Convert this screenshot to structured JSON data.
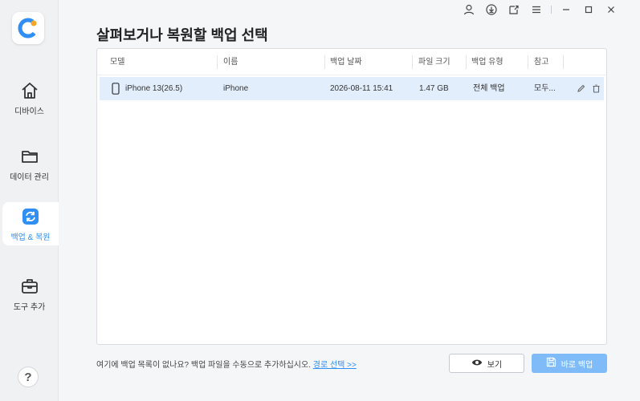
{
  "sidebar": {
    "items": [
      {
        "label": "디바이스",
        "icon": "home-icon"
      },
      {
        "label": "데이터 관리",
        "icon": "folder-icon"
      },
      {
        "label": "백업 & 복원",
        "icon": "sync-icon",
        "active": true
      },
      {
        "label": "도구 추가",
        "icon": "toolbox-icon"
      }
    ],
    "help": "?"
  },
  "page": {
    "title": "살펴보거나 복원할 백업 선택"
  },
  "table": {
    "headers": [
      "모델",
      "이름",
      "백업 날짜",
      "파일 크기",
      "백업 유형",
      "참고"
    ],
    "rows": [
      {
        "model": "iPhone 13(26.5)",
        "name": "iPhone",
        "date": "2026-08-11 15:41",
        "size": "1.47 GB",
        "type": "전체 백업",
        "note": "모두..."
      }
    ]
  },
  "footer": {
    "hint": "여기에 백업 목록이 없나요? 백업 파일을 수동으로 추가하십시오. ",
    "link": "경로 선택 >>",
    "view_label": "보기",
    "backup_label": "바로 백업"
  },
  "colors": {
    "accent": "#2f8ff5",
    "selected_row": "#e3eefc",
    "primary_button": "#7fbbf9"
  }
}
